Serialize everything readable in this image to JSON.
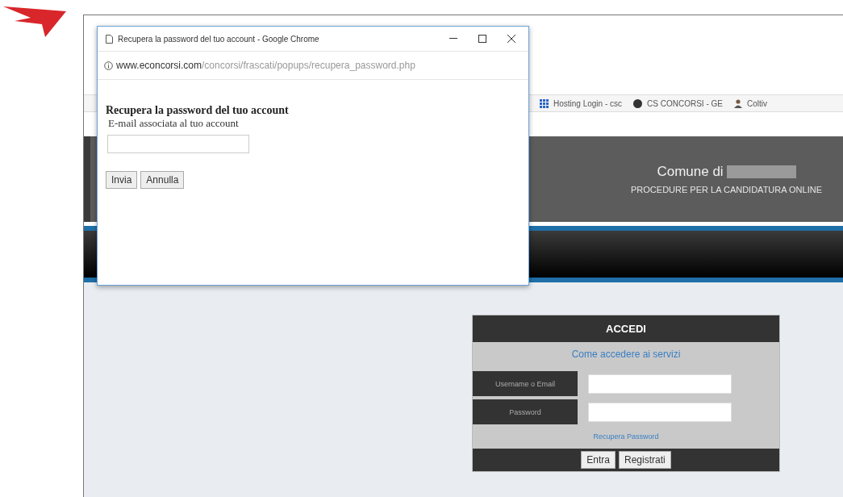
{
  "popup": {
    "title": "Recupera la password del tuo account - Google Chrome",
    "url_domain": "www.econcorsi.com",
    "url_path": "/concorsi/frascati/popups/recupera_password.php",
    "heading": "Recupera la password del tuo account",
    "field_label": "E-mail associata al tuo account",
    "buttons": [
      "Invia",
      "Annulla"
    ]
  },
  "bookmarks": [
    {
      "label": "Hosting Login - csc",
      "kind": "grid"
    },
    {
      "label": "CS CONCORSI - GE",
      "kind": "dark"
    },
    {
      "label": "Coltiv",
      "kind": "person"
    }
  ],
  "header": {
    "title": "Comune di",
    "subtitle": "PROCEDURE PER LA CANDIDATURA ONLINE"
  },
  "login": {
    "title": "ACCEDI",
    "help_link": "Come accedere ai servizi",
    "fields": [
      {
        "label": "Username o Email"
      },
      {
        "label": "Password"
      }
    ],
    "recover_link": "Recupera Password",
    "buttons": [
      "Entra",
      "Registrati"
    ]
  }
}
